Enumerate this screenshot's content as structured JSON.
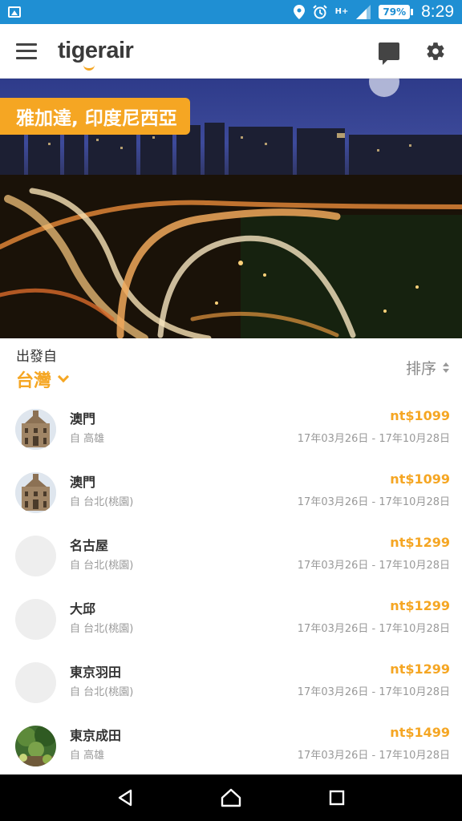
{
  "status_bar": {
    "battery": "79%",
    "time": "8:29",
    "network": "H+"
  },
  "app_bar": {
    "logo": "tigerair"
  },
  "hero": {
    "destination": "雅加達, 印度尼西亞"
  },
  "origin": {
    "label": "出發自",
    "value": "台灣"
  },
  "sort": {
    "label": "排序"
  },
  "deals": [
    {
      "city": "澳門",
      "from": "自 高雄",
      "price": "nt$1099",
      "dates": "17年03月26日 - 17年10月28日",
      "thumb": "macau"
    },
    {
      "city": "澳門",
      "from": "自 台北(桃園)",
      "price": "nt$1099",
      "dates": "17年03月26日 - 17年10月28日",
      "thumb": "macau"
    },
    {
      "city": "名古屋",
      "from": "自 台北(桃園)",
      "price": "nt$1299",
      "dates": "17年03月26日 - 17年10月28日",
      "thumb": "blank"
    },
    {
      "city": "大邱",
      "from": "自 台北(桃園)",
      "price": "nt$1299",
      "dates": "17年03月26日 - 17年10月28日",
      "thumb": "blank"
    },
    {
      "city": "東京羽田",
      "from": "自 台北(桃園)",
      "price": "nt$1299",
      "dates": "17年03月26日 - 17年10月28日",
      "thumb": "blank"
    },
    {
      "city": "東京成田",
      "from": "自 高雄",
      "price": "nt$1499",
      "dates": "17年03月26日 - 17年10月28日",
      "thumb": "garden"
    }
  ],
  "colors": {
    "status_bar": "#1f8fd3",
    "accent": "#f5a623",
    "text_primary": "#333333",
    "text_secondary": "#999999"
  }
}
